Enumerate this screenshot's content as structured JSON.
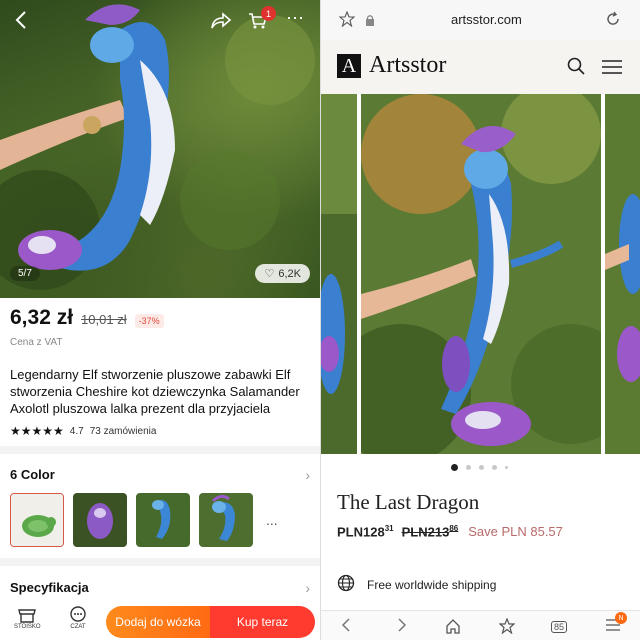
{
  "left": {
    "image_counter": "5/7",
    "likes": "6,2K",
    "cart_badge": "1",
    "price": "6,32 zł",
    "old_price": "10,01 zł",
    "discount": "-37%",
    "vat_note": "Cena z VAT",
    "title": "Legendarny Elf stworzenie pluszowe zabawki Elf stworzenia Cheshire kot dziewczynka Salamander Axolotl pluszowa lalka prezent dla przyjaciela",
    "rating": "4.7",
    "orders": "73 zamówienia",
    "color_section": "6 Color",
    "more": "...",
    "spec_section": "Specyfikacja",
    "tabs": {
      "store": "STOISKO",
      "chat": "CZAT"
    },
    "add_to_cart": "Dodaj do wózka",
    "buy_now": "Kup teraz"
  },
  "right": {
    "url": "artsstor.com",
    "brand": "Artsstor",
    "brand_mark": "A",
    "product_title": "The Last Dragon",
    "price_now_main": "PLN128",
    "price_now_cents": "31",
    "price_old_main": "PLN213",
    "price_old_cents": "86",
    "save": "Save PLN 85.57",
    "shipping": "Free worldwide shipping",
    "tabs_count": "85",
    "menu_badge": "N"
  },
  "colors": {
    "accent_orange": "#ff7a18",
    "accent_red": "#ff3b2f",
    "save_text": "#b96a6a"
  }
}
